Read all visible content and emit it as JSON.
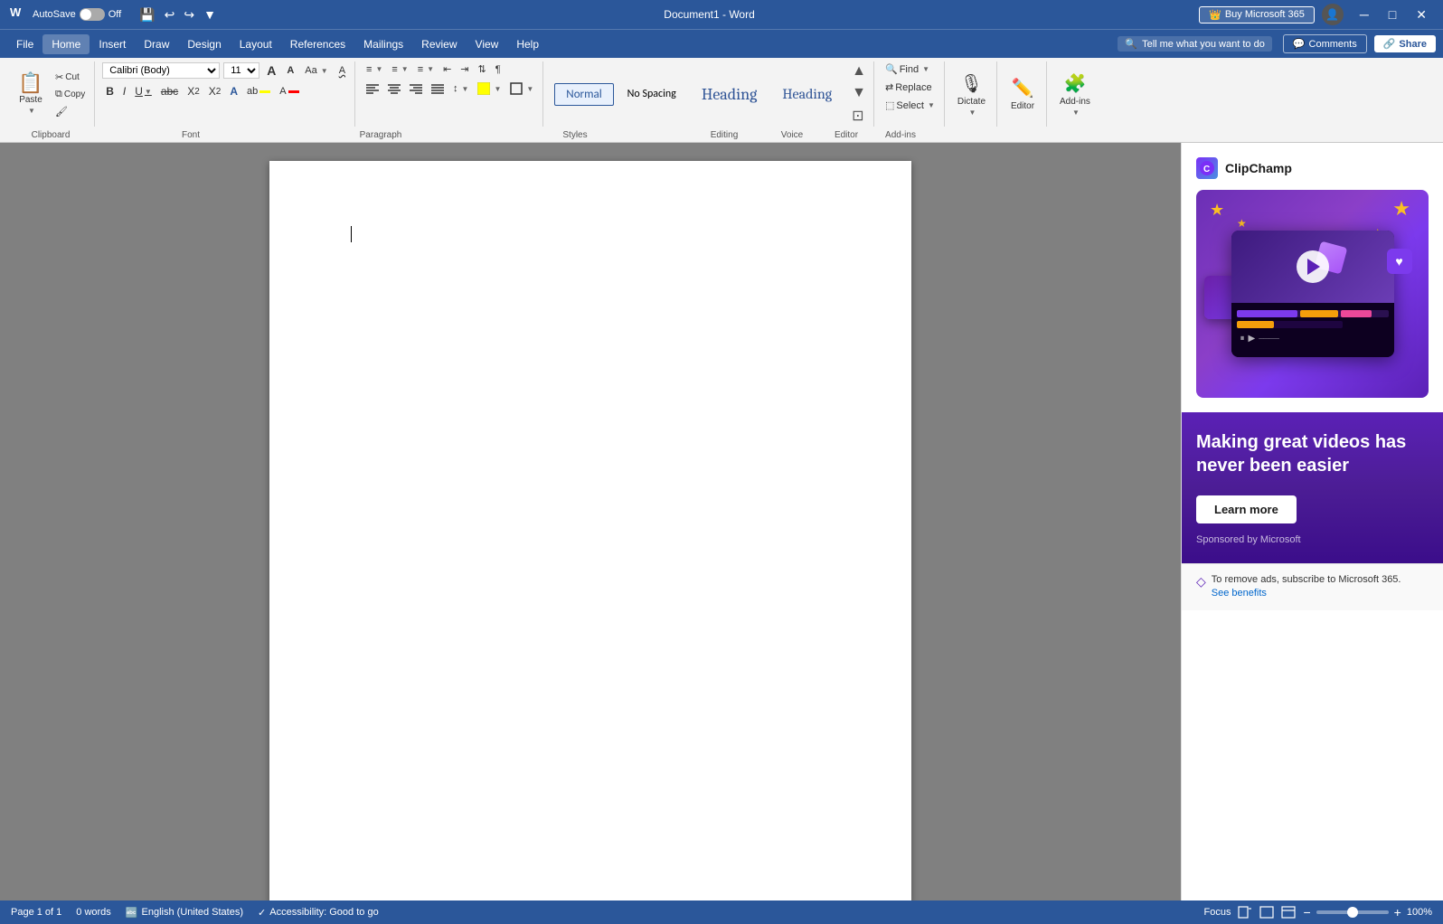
{
  "titleBar": {
    "appName": "Word",
    "docName": "Document1 - Word",
    "autoSave": "AutoSave",
    "autoSaveState": "Off",
    "buyBtn": "Buy Microsoft 365",
    "profileTitle": "Profile"
  },
  "menuBar": {
    "items": [
      "File",
      "Home",
      "Insert",
      "Draw",
      "Design",
      "Layout",
      "References",
      "Mailings",
      "Review",
      "View",
      "Help"
    ],
    "activeItem": "Home",
    "searchPlaceholder": "Tell me what you want to do",
    "commentsBtn": "Comments",
    "shareBtn": "Share"
  },
  "ribbon": {
    "clipboard": {
      "label": "Clipboard",
      "paste": "Paste",
      "cut": "Cut",
      "copy": "Copy",
      "formatPainter": "Format Painter"
    },
    "font": {
      "label": "Font",
      "fontName": "Calibri (Body)",
      "fontSize": "11",
      "growFont": "A",
      "shrinkFont": "A",
      "changeCaseBtn": "Aa",
      "clearFormatting": "A",
      "bold": "B",
      "italic": "I",
      "underline": "U",
      "strikethrough": "abc",
      "subscript": "X₂",
      "superscript": "X²",
      "fontColor": "A",
      "highlight": "ab"
    },
    "paragraph": {
      "label": "Paragraph",
      "bullets": "≡",
      "numbering": "≡",
      "multilevel": "≡",
      "decreaseIndent": "←",
      "increaseIndent": "→",
      "sort": "↕",
      "showHide": "¶",
      "alignLeft": "≡",
      "center": "≡",
      "alignRight": "≡",
      "justify": "≡",
      "lineSpacing": "≡",
      "shading": "■",
      "borders": "□"
    },
    "styles": {
      "label": "Styles",
      "items": [
        "Normal",
        "No Spacing",
        "Heading 1",
        "Heading 2"
      ],
      "activeStyle": "Normal"
    },
    "editing": {
      "label": "Editing",
      "find": "Find",
      "replace": "Replace",
      "select": "Select"
    },
    "voice": {
      "label": "Voice",
      "dictate": "Dictate"
    },
    "editor": {
      "label": "Editor",
      "editor": "Editor"
    },
    "addIns": {
      "label": "Add-ins",
      "addIns": "Add-ins"
    }
  },
  "document": {
    "pageInfo": "Page 1 of 1",
    "wordCount": "0 words",
    "language": "English (United States)",
    "accessibility": "Accessibility: Good to go"
  },
  "sidePanel": {
    "clipchamp": {
      "title": "ClipChamp",
      "adHeading": "Making great videos has never been easier",
      "learnMore": "Learn more",
      "sponsored": "Sponsored by Microsoft",
      "removeAds": "To remove ads, subscribe to Microsoft 365.",
      "seeBenefits": "See benefits"
    }
  },
  "statusBar": {
    "page": "Page 1 of 1",
    "words": "0 words",
    "language": "English (United States)",
    "accessibility": "Accessibility: Good to go",
    "focus": "Focus",
    "zoom": "100%"
  }
}
